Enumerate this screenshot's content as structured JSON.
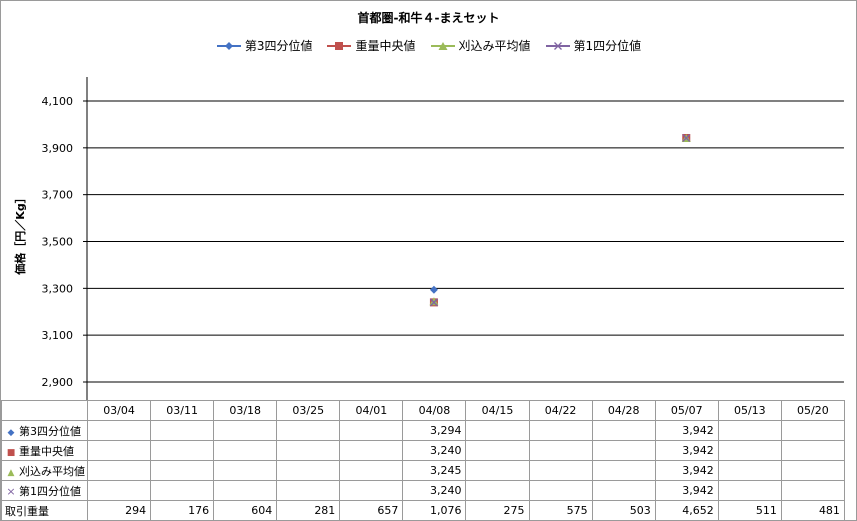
{
  "chart_data": {
    "type": "line",
    "title": "首都圏-和牛４-まえセット",
    "ylabel": "価格［円／Kg］",
    "xlabel": "",
    "ylim": [
      2900,
      4100
    ],
    "yticks": [
      2900,
      3100,
      3300,
      3500,
      3700,
      3900,
      4100
    ],
    "ytick_labels": [
      "2,900",
      "3,100",
      "3,300",
      "3,500",
      "3,700",
      "3,900",
      "4,100"
    ],
    "grid": true,
    "legend_position": "top",
    "categories": [
      "03/04",
      "03/11",
      "03/18",
      "03/25",
      "04/01",
      "04/08",
      "04/15",
      "04/22",
      "04/28",
      "05/07",
      "05/13",
      "05/20"
    ],
    "series": [
      {
        "name": "第3四分位値",
        "color": "#4472c4",
        "marker": "diamond",
        "values": [
          null,
          null,
          null,
          null,
          null,
          3294,
          null,
          null,
          null,
          3942,
          null,
          null
        ],
        "labels": [
          "",
          "",
          "",
          "",
          "",
          "3,294",
          "",
          "",
          "",
          "3,942",
          "",
          ""
        ]
      },
      {
        "name": "重量中央値",
        "color": "#c0504d",
        "marker": "square",
        "values": [
          null,
          null,
          null,
          null,
          null,
          3240,
          null,
          null,
          null,
          3942,
          null,
          null
        ],
        "labels": [
          "",
          "",
          "",
          "",
          "",
          "3,240",
          "",
          "",
          "",
          "3,942",
          "",
          ""
        ]
      },
      {
        "name": "刈込み平均値",
        "color": "#9bbb59",
        "marker": "triangle",
        "values": [
          null,
          null,
          null,
          null,
          null,
          3245,
          null,
          null,
          null,
          3942,
          null,
          null
        ],
        "labels": [
          "",
          "",
          "",
          "",
          "",
          "3,245",
          "",
          "",
          "",
          "3,942",
          "",
          ""
        ]
      },
      {
        "name": "第1四分位値",
        "color": "#8064a2",
        "marker": "x",
        "values": [
          null,
          null,
          null,
          null,
          null,
          3240,
          null,
          null,
          null,
          3942,
          null,
          null
        ],
        "labels": [
          "",
          "",
          "",
          "",
          "",
          "3,240",
          "",
          "",
          "",
          "3,942",
          "",
          ""
        ]
      }
    ],
    "volume_row": {
      "name": "取引重量",
      "values": [
        294,
        176,
        604,
        281,
        657,
        1076,
        275,
        575,
        503,
        4652,
        511,
        481
      ],
      "labels": [
        "294",
        "176",
        "604",
        "281",
        "657",
        "1,076",
        "275",
        "575",
        "503",
        "4,652",
        "511",
        "481"
      ]
    }
  }
}
